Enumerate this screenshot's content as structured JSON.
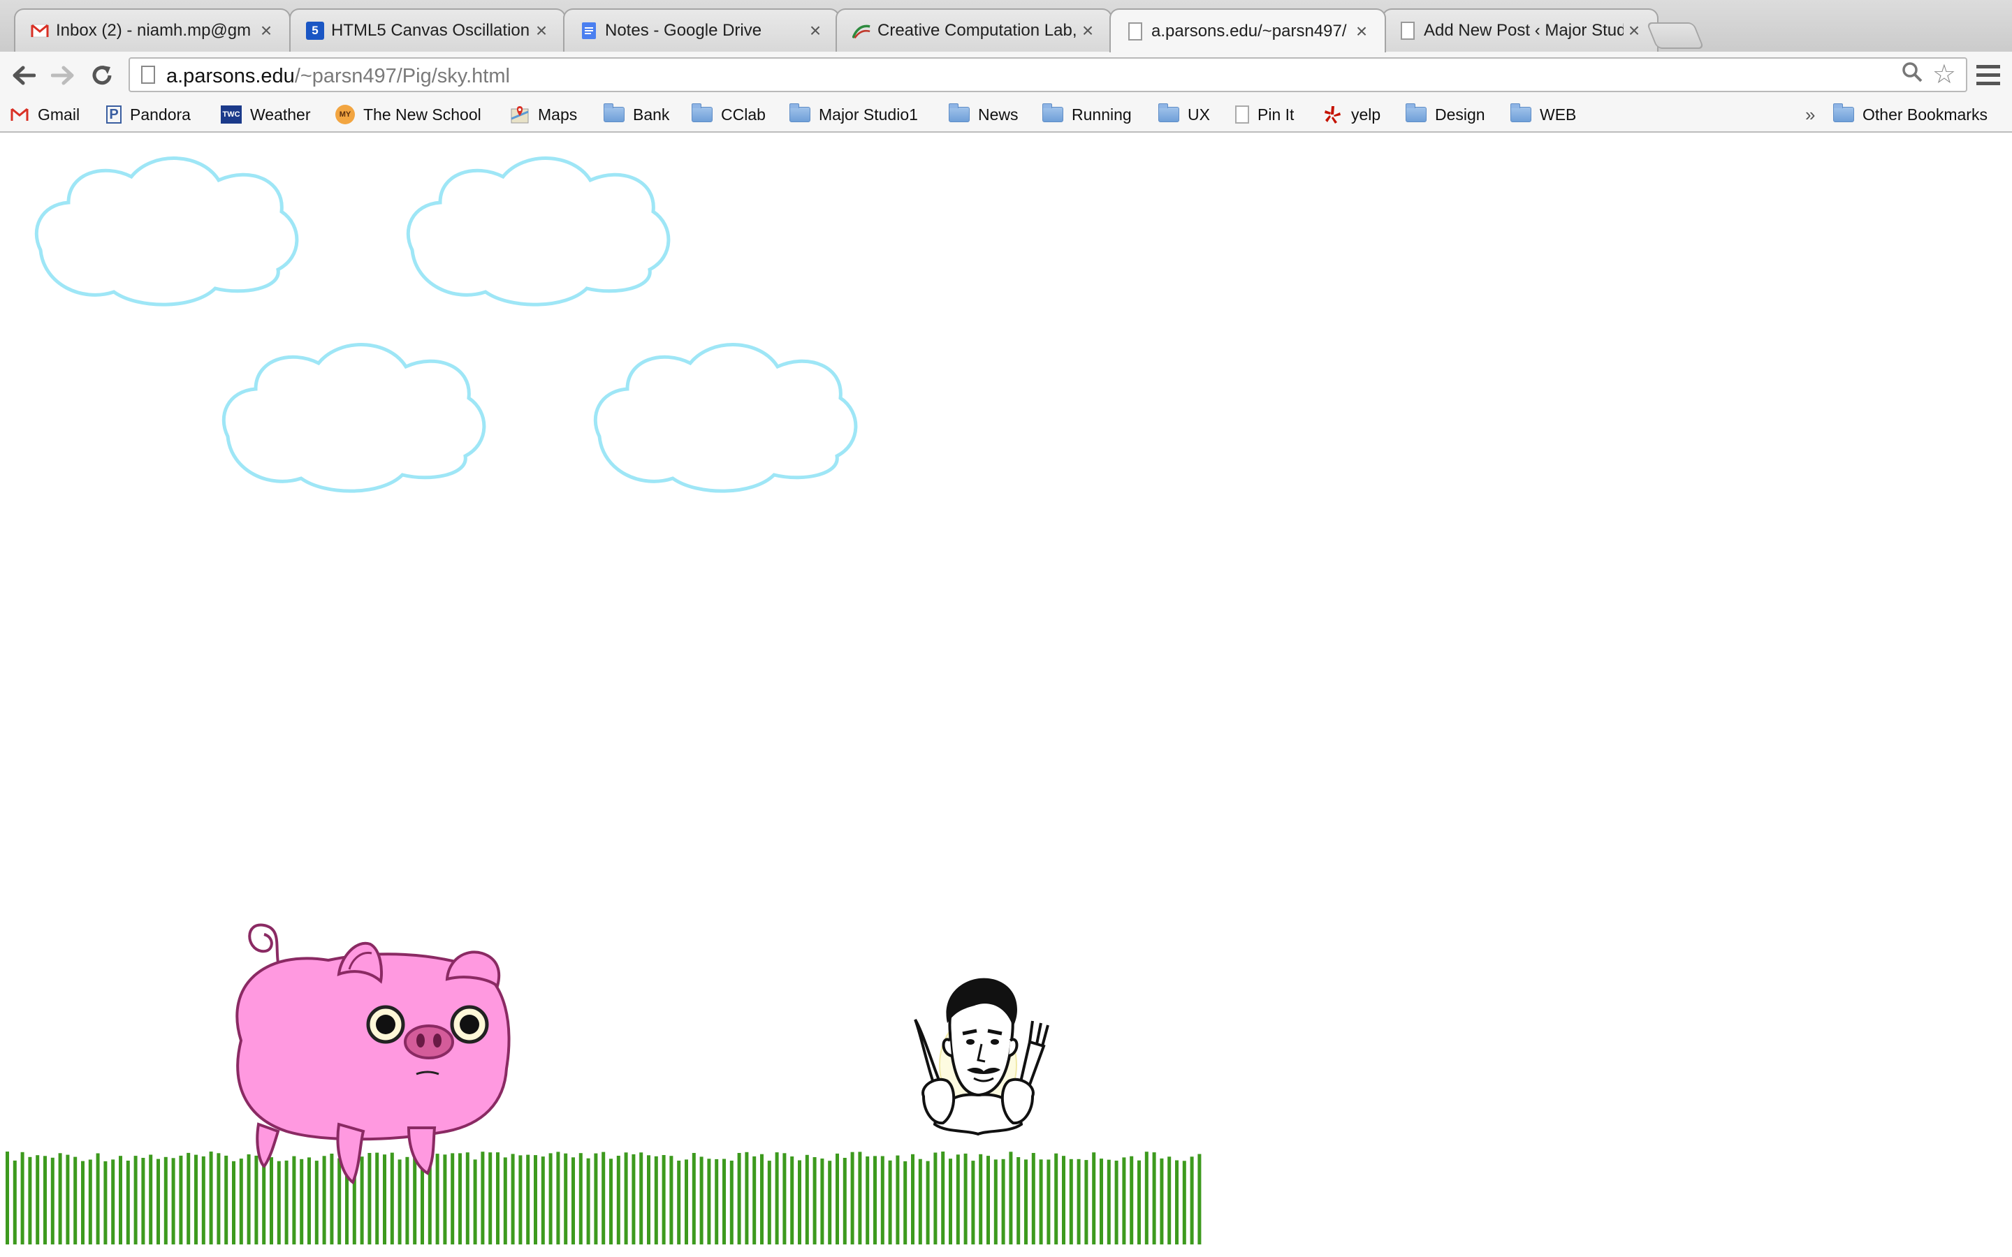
{
  "tabs": [
    {
      "title": "Inbox (2) - niamh.mp@gm",
      "icon": "gmail-icon",
      "active": false
    },
    {
      "title": "HTML5 Canvas Oscillation",
      "icon": "html5-icon",
      "active": false
    },
    {
      "title": "Notes - Google Drive",
      "icon": "google-docs-icon",
      "active": false
    },
    {
      "title": "Creative Computation Lab,",
      "icon": "creative-computation-lab-icon",
      "active": false
    },
    {
      "title": "a.parsons.edu/~parsn497/",
      "icon": "page-icon",
      "active": true
    },
    {
      "title": "Add New Post ‹ Major Stud",
      "icon": "page-icon",
      "active": false
    }
  ],
  "toolbar": {
    "url_host": "a.parsons.edu",
    "url_path": "/~parsn497/Pig/sky.html"
  },
  "bookmarks": [
    {
      "label": "Gmail",
      "icon": "gmail-icon"
    },
    {
      "label": "Pandora",
      "icon": "pandora-icon"
    },
    {
      "label": "Weather",
      "icon": "weather-channel-icon",
      "icon_text": "TWC"
    },
    {
      "label": "The New School",
      "icon": "mynewschool-icon",
      "icon_text": "MY"
    },
    {
      "label": "Maps",
      "icon": "google-maps-icon"
    },
    {
      "label": "Bank",
      "icon": "folder-icon"
    },
    {
      "label": "CClab",
      "icon": "folder-icon"
    },
    {
      "label": "Major Studio1",
      "icon": "folder-icon"
    },
    {
      "label": "News",
      "icon": "folder-icon"
    },
    {
      "label": "Running",
      "icon": "folder-icon"
    },
    {
      "label": "UX",
      "icon": "folder-icon"
    },
    {
      "label": "Pin It",
      "icon": "page-icon"
    },
    {
      "label": "yelp",
      "icon": "yelp-icon"
    },
    {
      "label": "Design",
      "icon": "folder-icon"
    },
    {
      "label": "WEB",
      "icon": "folder-icon"
    }
  ],
  "bookmarks_overflow": "»",
  "other_bookmarks": "Other Bookmarks",
  "scene": {
    "cloud_color": "#9ee6f6",
    "grass_color": "#3d9a1e",
    "pig_color": "#ff99e0",
    "pig_outline": "#8a2a63",
    "pig_snout": "#d45c9a",
    "characters": [
      "pig",
      "chef"
    ]
  }
}
